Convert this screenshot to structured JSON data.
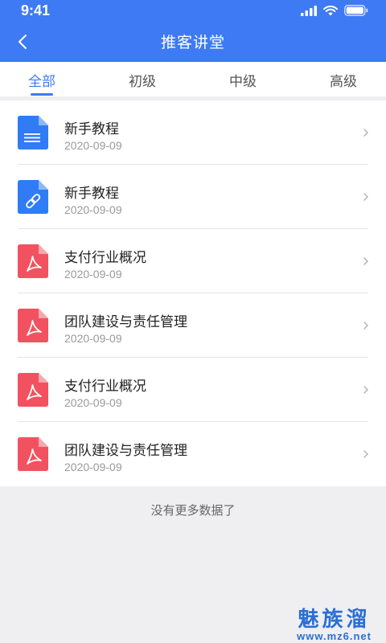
{
  "status_bar": {
    "time": "9:41"
  },
  "nav": {
    "title": "推客讲堂"
  },
  "tabs": [
    {
      "label": "全部"
    },
    {
      "label": "初级"
    },
    {
      "label": "中级"
    },
    {
      "label": "高级"
    }
  ],
  "items": [
    {
      "title": "新手教程",
      "date": "2020-09-09",
      "icon": "doc-icon"
    },
    {
      "title": "新手教程",
      "date": "2020-09-09",
      "icon": "link-icon"
    },
    {
      "title": "支付行业概况",
      "date": "2020-09-09",
      "icon": "pdf-icon"
    },
    {
      "title": "团队建设与责任管理",
      "date": "2020-09-09",
      "icon": "pdf-icon"
    },
    {
      "title": "支付行业概况",
      "date": "2020-09-09",
      "icon": "pdf-icon"
    },
    {
      "title": "团队建设与责任管理",
      "date": "2020-09-09",
      "icon": "pdf-icon"
    }
  ],
  "footer": {
    "no_more": "没有更多数据了"
  },
  "watermark": {
    "name": "魅族溜",
    "url": "www.mz6.net"
  },
  "colors": {
    "accent": "#3e7af3",
    "doc_blue": "#2f7cf6",
    "pdf_red": "#f2525f"
  }
}
